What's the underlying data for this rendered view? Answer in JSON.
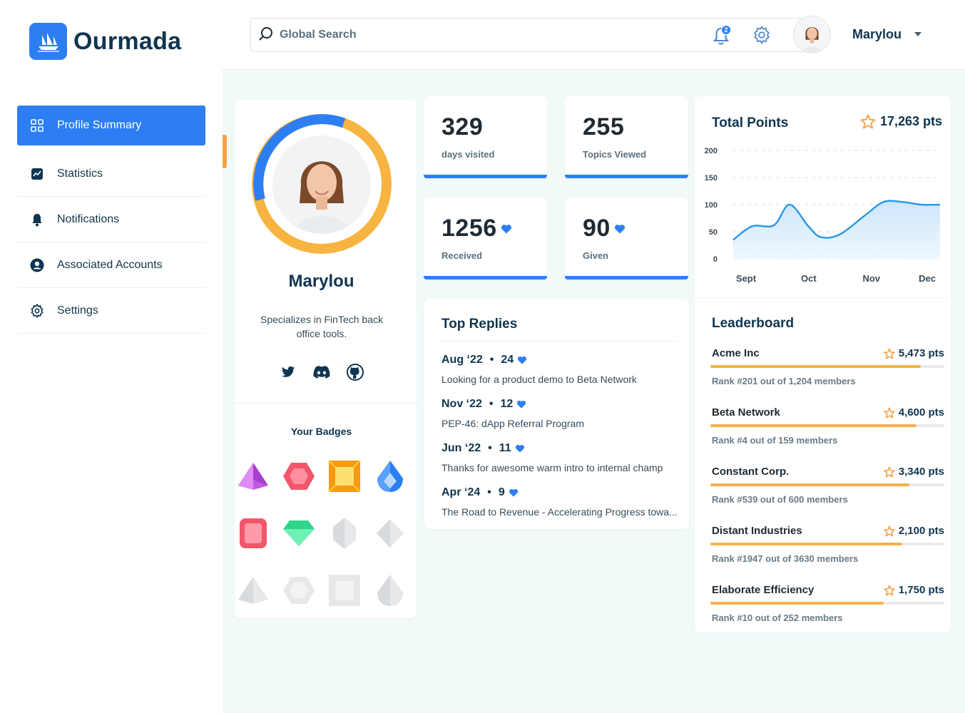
{
  "app": {
    "name": "Ourmada"
  },
  "colors": {
    "primary": "#2d7ef2",
    "accent": "#f5b14a",
    "text": "#0f3550"
  },
  "sidebar": {
    "items": [
      {
        "label": "Profile Summary",
        "icon": "grid-icon",
        "active": true
      },
      {
        "label": "Statistics",
        "icon": "chart-icon"
      },
      {
        "label": "Notifications",
        "icon": "bell-icon"
      },
      {
        "label": "Associated Accounts",
        "icon": "user-circle-icon"
      },
      {
        "label": "Settings",
        "icon": "gear-icon"
      }
    ]
  },
  "header": {
    "search_placeholder": "Global Search",
    "notification_count": "2",
    "user_name": "Marylou"
  },
  "profile": {
    "name": "Marylou",
    "bio": "Specializes in FinTech back office tools.",
    "socials": [
      "twitter-icon",
      "discord-icon",
      "github-icon"
    ],
    "badges_title": "Your Badges",
    "badges": [
      {
        "icon": "purple-pyramid-gem-icon",
        "earned": true
      },
      {
        "icon": "red-hexagon-gem-icon",
        "earned": true
      },
      {
        "icon": "yellow-square-gem-icon",
        "earned": true
      },
      {
        "icon": "blue-drop-gem-icon",
        "earned": true
      },
      {
        "icon": "pink-ruby-gem-icon",
        "earned": true
      },
      {
        "icon": "green-diamond-gem-icon",
        "earned": true
      },
      {
        "icon": "gray-oval-gem-icon",
        "earned": false
      },
      {
        "icon": "gray-star-gem-icon",
        "earned": false
      },
      {
        "icon": "gray-pyramid-gem-icon",
        "earned": false
      },
      {
        "icon": "gray-hexagon-gem-icon",
        "earned": false
      },
      {
        "icon": "gray-square-gem-icon",
        "earned": false
      },
      {
        "icon": "gray-drop-gem-icon",
        "earned": false
      }
    ]
  },
  "stats": [
    {
      "value": "329",
      "label": "days visited",
      "heart": false
    },
    {
      "value": "255",
      "label": "Topics Viewed",
      "heart": false
    },
    {
      "value": "1256",
      "label": "Received",
      "heart": true
    },
    {
      "value": "90",
      "label": "Given",
      "heart": true
    }
  ],
  "top_replies": {
    "title": "Top Replies",
    "items": [
      {
        "date": "Aug ‘22",
        "likes": "24",
        "text": "Looking for a product demo to Beta Network"
      },
      {
        "date": "Nov ‘22",
        "likes": "12",
        "text": "PEP-46: dApp Referral Program"
      },
      {
        "date": "Jun ‘22",
        "likes": "11",
        "text": "Thanks for  awesome warm intro to internal champ"
      },
      {
        "date": "Apr ‘24",
        "likes": "9",
        "text": "The Road to Revenue - Accelerating Progress towa..."
      }
    ]
  },
  "total_points": {
    "title": "Total Points",
    "value": "17,263 pts"
  },
  "chart_data": {
    "type": "area",
    "title": "Total Points",
    "xlabel": "",
    "ylabel": "",
    "categories": [
      "Sept",
      "Oct",
      "Nov",
      "Dec"
    ],
    "yticks": [
      "200",
      "150",
      "100",
      "50",
      "0"
    ],
    "ylim": [
      0,
      200
    ],
    "grid": true,
    "x": [
      0,
      0.3,
      0.65,
      0.9,
      1.2,
      1.4,
      1.7,
      2.1,
      2.4,
      2.7,
      3.0,
      3.3
    ],
    "values": [
      35,
      60,
      62,
      100,
      60,
      40,
      45,
      80,
      105,
      105,
      100,
      100
    ]
  },
  "leaderboard": {
    "title": "Leaderboard",
    "items": [
      {
        "name": "Acme Inc",
        "points": "5,473  pts",
        "progress": 0.9,
        "rank": "Rank #201 out of 1,204 members"
      },
      {
        "name": "Beta Network",
        "points": "4,600 pts",
        "progress": 0.88,
        "rank": "Rank #4 out of 159 members"
      },
      {
        "name": "Constant Corp.",
        "points": "3,340 pts",
        "progress": 0.85,
        "rank": "Rank #539 out of 600 members"
      },
      {
        "name": "Distant Industries",
        "points": "2,100 pts",
        "progress": 0.82,
        "rank": "Rank #1947 out of 3630 members"
      },
      {
        "name": "Elaborate Efficiency",
        "points": "1,750 pts",
        "progress": 0.74,
        "rank": "Rank #10 out of 252 members"
      }
    ]
  }
}
